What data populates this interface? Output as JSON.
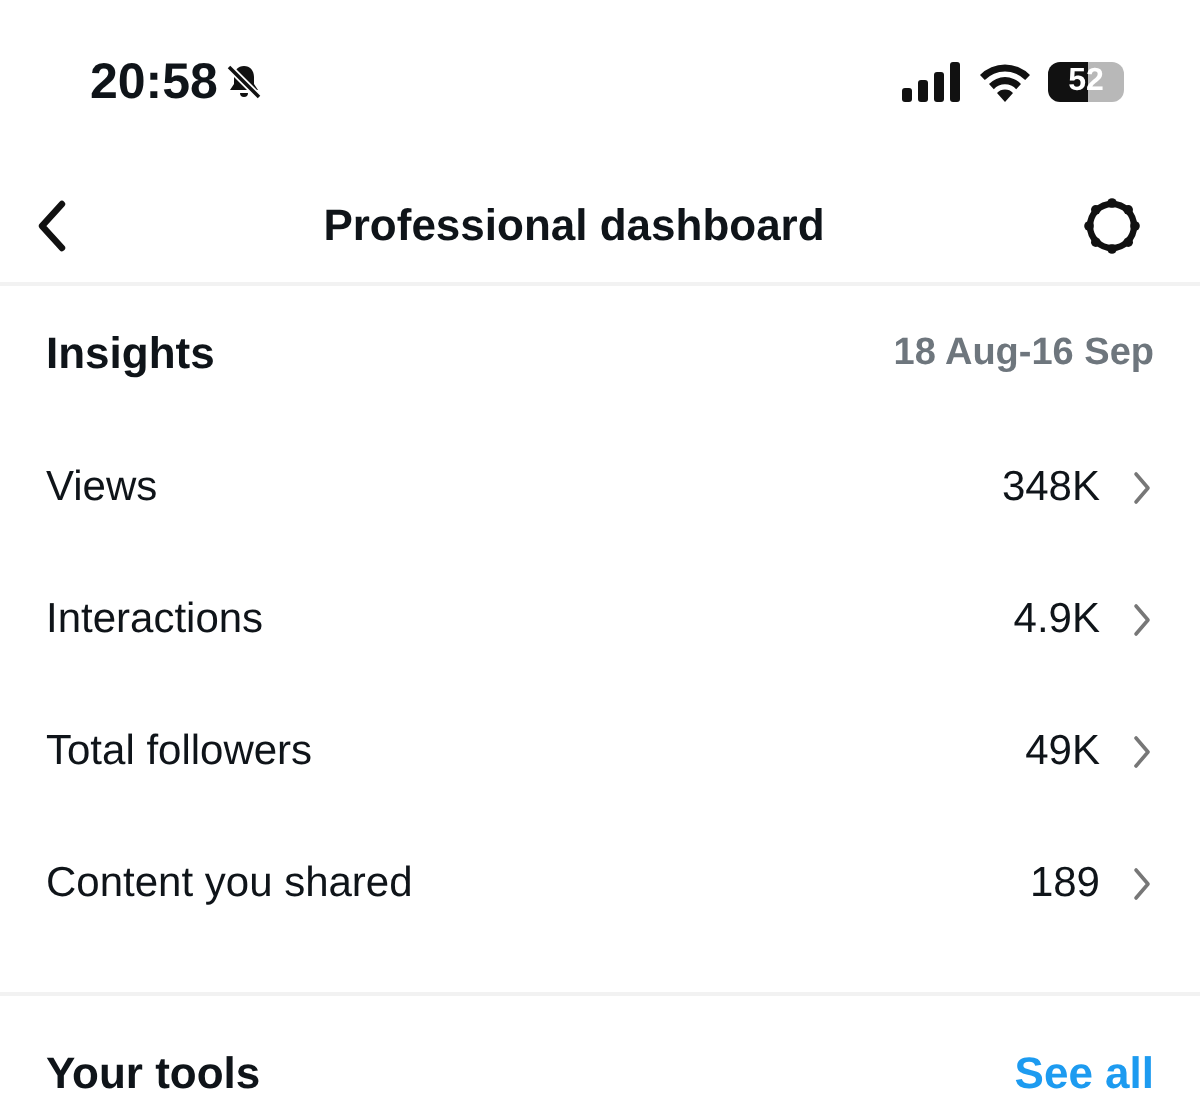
{
  "status_bar": {
    "time": "20:58",
    "battery": "52"
  },
  "header": {
    "title": "Professional dashboard"
  },
  "insights": {
    "title": "Insights",
    "date_range": "18 Aug-16 Sep",
    "rows": [
      {
        "label": "Views",
        "value": "348K"
      },
      {
        "label": "Interactions",
        "value": "4.9K"
      },
      {
        "label": "Total followers",
        "value": "49K"
      },
      {
        "label": "Content you shared",
        "value": "189"
      }
    ]
  },
  "tools": {
    "title": "Your tools",
    "link": "See all"
  }
}
